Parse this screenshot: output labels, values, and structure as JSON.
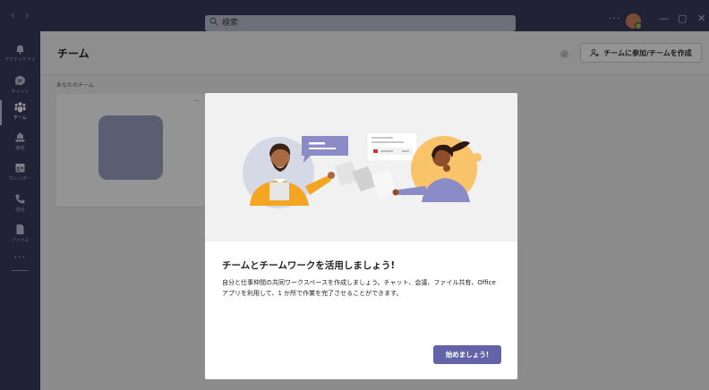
{
  "titlebar": {
    "back_glyph": "‹",
    "forward_glyph": "›",
    "search_placeholder": "検索",
    "more_glyph": "···",
    "minimize_glyph": "—",
    "maximize_glyph": "▢",
    "close_glyph": "✕"
  },
  "rail": {
    "items": [
      {
        "label": "アクティビティ",
        "icon": "bell-icon"
      },
      {
        "label": "チャット",
        "icon": "chat-icon"
      },
      {
        "label": "チーム",
        "icon": "teams-icon"
      },
      {
        "label": "課題",
        "icon": "assignments-icon"
      },
      {
        "label": "カレンダー",
        "icon": "calendar-icon"
      },
      {
        "label": "通話",
        "icon": "phone-icon"
      },
      {
        "label": "ファイル",
        "icon": "file-icon"
      }
    ],
    "more_glyph": "···"
  },
  "header": {
    "title": "チーム",
    "join_button": "チームに参加/チームを作成"
  },
  "section": {
    "your_teams_label": "あなたのチーム",
    "card_more_glyph": "···"
  },
  "dialog": {
    "title": "チームとチームワークを活用しましょう!",
    "body": "自分と仕事仲間の共同ワークスペースを作成しましょう。チャット、会議、ファイル共有、Office アプリを利用して、1 か所で作業を完了させることができます。",
    "start_button": "始めましょう!"
  },
  "colors": {
    "rail_bg": "#3a3b5c",
    "accent": "#6264a7",
    "presence": "#92c353"
  }
}
